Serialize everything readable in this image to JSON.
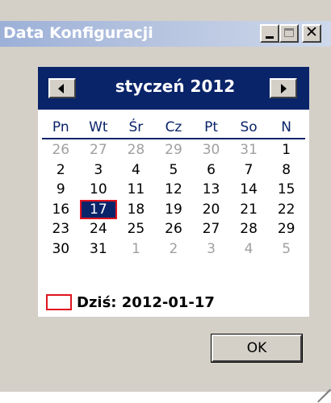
{
  "window": {
    "title": "Data Konfiguracji",
    "close_glyph": "✕"
  },
  "calendar": {
    "month_label": "styczeń 2012",
    "day_names": [
      "Pn",
      "Wt",
      "Śr",
      "Cz",
      "Pt",
      "So",
      "N"
    ],
    "weeks": [
      [
        "26",
        "27",
        "28",
        "29",
        "30",
        "31",
        "1"
      ],
      [
        "2",
        "3",
        "4",
        "5",
        "6",
        "7",
        "8"
      ],
      [
        "9",
        "10",
        "11",
        "12",
        "13",
        "14",
        "15"
      ],
      [
        "16",
        "17",
        "18",
        "19",
        "20",
        "21",
        "22"
      ],
      [
        "23",
        "24",
        "25",
        "26",
        "27",
        "28",
        "29"
      ],
      [
        "30",
        "31",
        "1",
        "2",
        "3",
        "4",
        "5"
      ]
    ],
    "selected_day": "17",
    "today_label": "Dziś: 2012-01-17"
  },
  "buttons": {
    "ok_label": "OK"
  },
  "colors": {
    "header_bg": "#0a246a",
    "selection": "#0a246a",
    "today_marker": "#e0141e",
    "other_month_text": "#a0a0a0"
  }
}
